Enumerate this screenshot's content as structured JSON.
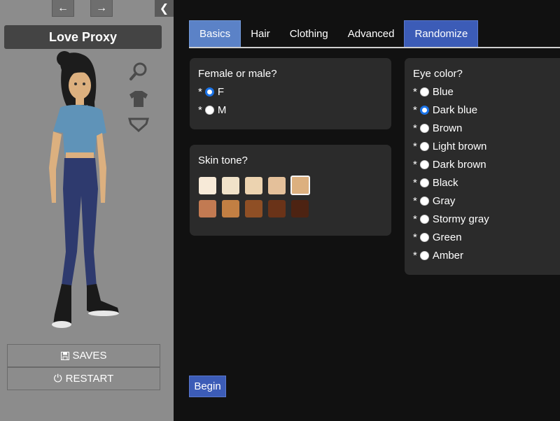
{
  "sidebar": {
    "nav_back_icon": "arrow-left-icon",
    "nav_forward_icon": "arrow-right-icon",
    "toggle_icon": "chevron-left-icon",
    "title": "Love Proxy",
    "tools": [
      "zoom-icon",
      "shirt-icon",
      "underwear-icon"
    ],
    "saves_label": "SAVES",
    "restart_label": "RESTART"
  },
  "tabs": [
    "Basics",
    "Hair",
    "Clothing",
    "Advanced",
    "Randomize"
  ],
  "active_tab": "Basics",
  "gender": {
    "question": "Female or male?",
    "required_mark": "*",
    "options": [
      "F",
      "M"
    ],
    "selected": "F"
  },
  "skin": {
    "question": "Skin tone?",
    "swatches": [
      "#f7ead8",
      "#f0e2c9",
      "#ecd3b0",
      "#e4c09a",
      "#dcb07f",
      "#c27a52",
      "#c27f43",
      "#8f4f25",
      "#6a3318",
      "#4d2312"
    ],
    "selected_index": 4
  },
  "eyes": {
    "question": "Eye color?",
    "required_mark": "*",
    "options": [
      "Blue",
      "Dark blue",
      "Brown",
      "Light brown",
      "Dark brown",
      "Black",
      "Gray",
      "Stormy gray",
      "Green",
      "Amber"
    ],
    "selected": "Dark blue"
  },
  "begin_label": "Begin",
  "colors": {
    "accent": "#3c5cb7",
    "active_tab": "#5b82c7",
    "card": "#2b2b2b",
    "sidebar": "#8c8c8c"
  }
}
